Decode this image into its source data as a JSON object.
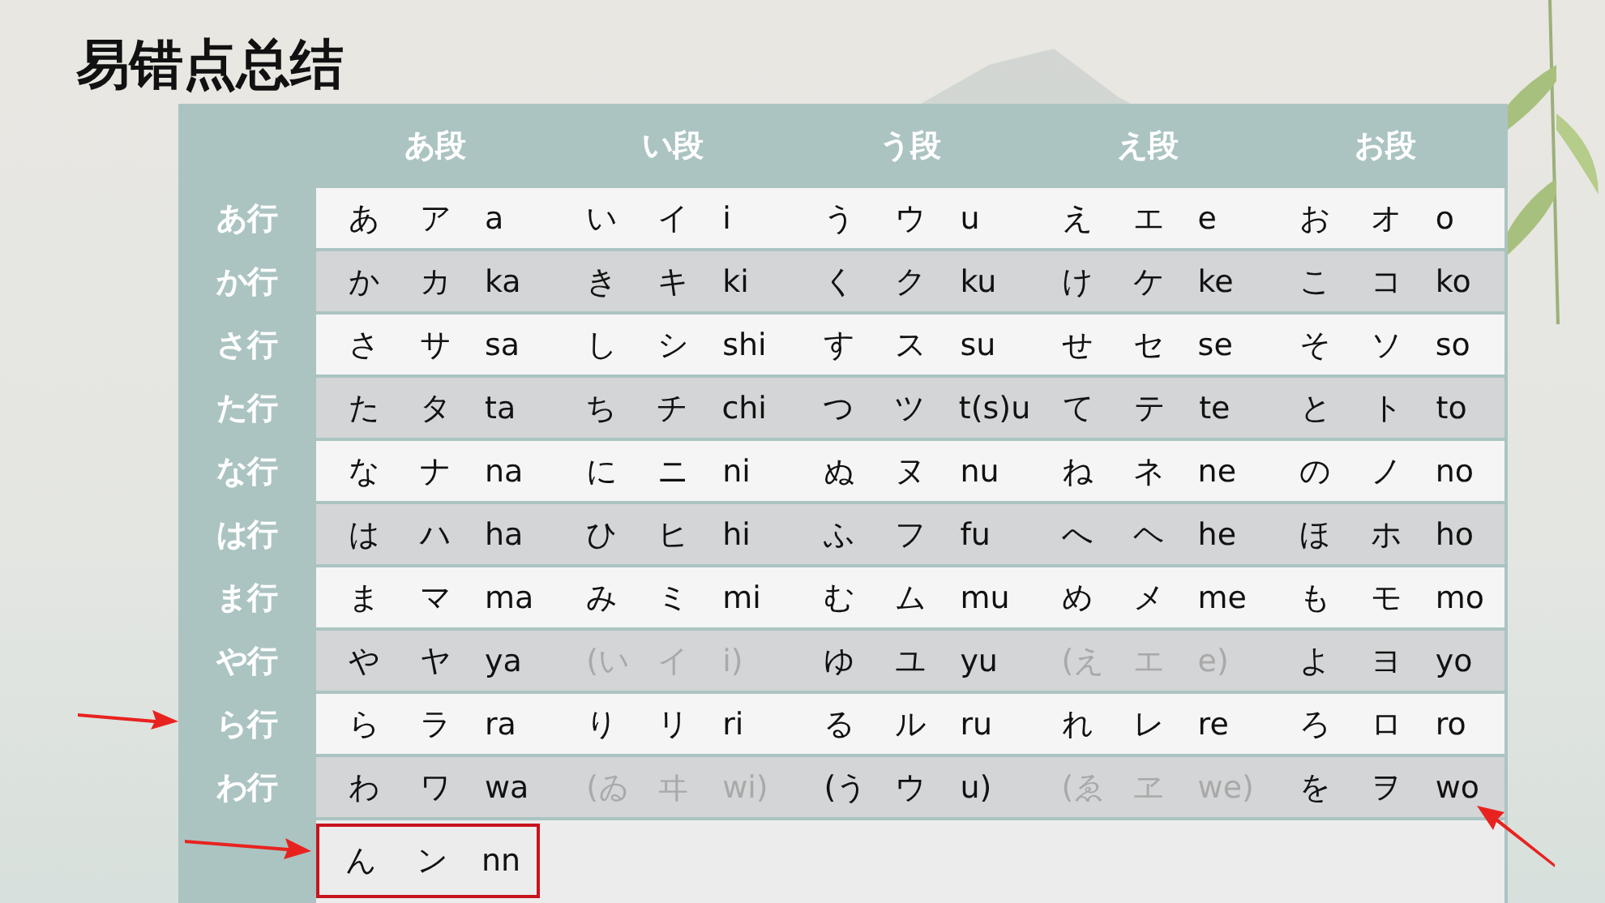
{
  "title": "易错点总结",
  "columns": [
    "あ段",
    "い段",
    "う段",
    "え段",
    "お段"
  ],
  "rows": [
    {
      "label": "あ行",
      "label_arrow": false,
      "end_arrow": false,
      "groups": [
        {
          "cells": [
            "あ",
            "ア",
            "a"
          ],
          "dim": false
        },
        {
          "cells": [
            "い",
            "イ",
            "i"
          ],
          "dim": false
        },
        {
          "cells": [
            "う",
            "ウ",
            "u"
          ],
          "dim": false
        },
        {
          "cells": [
            "え",
            "エ",
            "e"
          ],
          "dim": false
        },
        {
          "cells": [
            "お",
            "オ",
            "o"
          ],
          "dim": false
        }
      ]
    },
    {
      "label": "か行",
      "label_arrow": false,
      "end_arrow": false,
      "groups": [
        {
          "cells": [
            "か",
            "カ",
            "ka"
          ],
          "dim": false
        },
        {
          "cells": [
            "き",
            "キ",
            "ki"
          ],
          "dim": false
        },
        {
          "cells": [
            "く",
            "ク",
            "ku"
          ],
          "dim": false
        },
        {
          "cells": [
            "け",
            "ケ",
            "ke"
          ],
          "dim": false
        },
        {
          "cells": [
            "こ",
            "コ",
            "ko"
          ],
          "dim": false
        }
      ]
    },
    {
      "label": "さ行",
      "label_arrow": false,
      "end_arrow": false,
      "groups": [
        {
          "cells": [
            "さ",
            "サ",
            "sa"
          ],
          "dim": false
        },
        {
          "cells": [
            "し",
            "シ",
            "shi"
          ],
          "dim": false
        },
        {
          "cells": [
            "す",
            "ス",
            "su"
          ],
          "dim": false
        },
        {
          "cells": [
            "せ",
            "セ",
            "se"
          ],
          "dim": false
        },
        {
          "cells": [
            "そ",
            "ソ",
            "so"
          ],
          "dim": false
        }
      ]
    },
    {
      "label": "た行",
      "label_arrow": false,
      "end_arrow": false,
      "groups": [
        {
          "cells": [
            "た",
            "タ",
            "ta"
          ],
          "dim": false
        },
        {
          "cells": [
            "ち",
            "チ",
            "chi"
          ],
          "dim": false
        },
        {
          "cells": [
            "つ",
            "ツ",
            "t(s)u"
          ],
          "dim": false
        },
        {
          "cells": [
            "て",
            "テ",
            "te"
          ],
          "dim": false
        },
        {
          "cells": [
            "と",
            "ト",
            "to"
          ],
          "dim": false
        }
      ]
    },
    {
      "label": "な行",
      "label_arrow": false,
      "end_arrow": false,
      "groups": [
        {
          "cells": [
            "な",
            "ナ",
            "na"
          ],
          "dim": false
        },
        {
          "cells": [
            "に",
            "ニ",
            "ni"
          ],
          "dim": false
        },
        {
          "cells": [
            "ぬ",
            "ヌ",
            "nu"
          ],
          "dim": false
        },
        {
          "cells": [
            "ね",
            "ネ",
            "ne"
          ],
          "dim": false
        },
        {
          "cells": [
            "の",
            "ノ",
            "no"
          ],
          "dim": false
        }
      ]
    },
    {
      "label": "は行",
      "label_arrow": false,
      "end_arrow": false,
      "groups": [
        {
          "cells": [
            "は",
            "ハ",
            "ha"
          ],
          "dim": false
        },
        {
          "cells": [
            "ひ",
            "ヒ",
            "hi"
          ],
          "dim": false
        },
        {
          "cells": [
            "ふ",
            "フ",
            "fu"
          ],
          "dim": false
        },
        {
          "cells": [
            "へ",
            "ヘ",
            "he"
          ],
          "dim": false
        },
        {
          "cells": [
            "ほ",
            "ホ",
            "ho"
          ],
          "dim": false
        }
      ]
    },
    {
      "label": "ま行",
      "label_arrow": false,
      "end_arrow": false,
      "groups": [
        {
          "cells": [
            "ま",
            "マ",
            "ma"
          ],
          "dim": false
        },
        {
          "cells": [
            "み",
            "ミ",
            "mi"
          ],
          "dim": false
        },
        {
          "cells": [
            "む",
            "ム",
            "mu"
          ],
          "dim": false
        },
        {
          "cells": [
            "め",
            "メ",
            "me"
          ],
          "dim": false
        },
        {
          "cells": [
            "も",
            "モ",
            "mo"
          ],
          "dim": false
        }
      ]
    },
    {
      "label": "や行",
      "label_arrow": false,
      "end_arrow": false,
      "groups": [
        {
          "cells": [
            "や",
            "ヤ",
            "ya"
          ],
          "dim": false
        },
        {
          "cells": [
            "(い",
            "イ",
            "i)"
          ],
          "dim": true
        },
        {
          "cells": [
            "ゆ",
            "ユ",
            "yu"
          ],
          "dim": false
        },
        {
          "cells": [
            "(え",
            "エ",
            "e)"
          ],
          "dim": true
        },
        {
          "cells": [
            "よ",
            "ヨ",
            "yo"
          ],
          "dim": false
        }
      ]
    },
    {
      "label": "ら行",
      "label_arrow": true,
      "end_arrow": false,
      "groups": [
        {
          "cells": [
            "ら",
            "ラ",
            "ra"
          ],
          "dim": false
        },
        {
          "cells": [
            "り",
            "リ",
            "ri"
          ],
          "dim": false
        },
        {
          "cells": [
            "る",
            "ル",
            "ru"
          ],
          "dim": false
        },
        {
          "cells": [
            "れ",
            "レ",
            "re"
          ],
          "dim": false
        },
        {
          "cells": [
            "ろ",
            "ロ",
            "ro"
          ],
          "dim": false
        }
      ]
    },
    {
      "label": "わ行",
      "label_arrow": false,
      "end_arrow": true,
      "groups": [
        {
          "cells": [
            "わ",
            "ワ",
            "wa"
          ],
          "dim": false
        },
        {
          "cells": [
            "(ゐ",
            "ヰ",
            "wi)"
          ],
          "dim": true
        },
        {
          "cells": [
            "(う",
            "ウ",
            "u)"
          ],
          "dim": false
        },
        {
          "cells": [
            "(ゑ",
            "ヱ",
            "we)"
          ],
          "dim": true
        },
        {
          "cells": [
            "を",
            "ヲ",
            "wo"
          ],
          "dim": false
        }
      ]
    }
  ],
  "final_row": {
    "label_arrow": true,
    "boxed": true,
    "groups": [
      {
        "cells": [
          "ん",
          "ン",
          "nn"
        ],
        "dim": false
      }
    ]
  }
}
